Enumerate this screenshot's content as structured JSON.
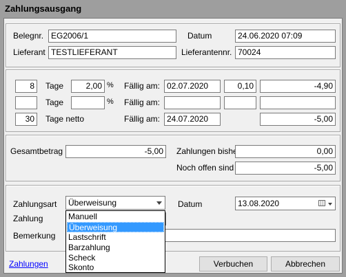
{
  "window": {
    "title": "Zahlungsausgang"
  },
  "header": {
    "belegnr_label": "Belegnr.",
    "belegnr_value": "EG2006/1",
    "datum_label": "Datum",
    "datum_value": "24.06.2020 07:09",
    "lieferant_label": "Lieferant",
    "lieferant_value": "TESTLIEFERANT",
    "lieferantennr_label": "Lieferantennr.",
    "lieferantennr_value": "70024"
  },
  "terms": {
    "rows": [
      {
        "days": "8",
        "tage_label": "Tage",
        "percent": "2,00",
        "pct_sign": "%",
        "faellig_label": "Fällig am:",
        "date": "02.07.2020",
        "amount_a": "0,10",
        "amount_b": "-4,90"
      },
      {
        "days": "",
        "tage_label": "Tage",
        "percent": "",
        "pct_sign": "%",
        "faellig_label": "Fällig am:",
        "date": "",
        "amount_a": "",
        "amount_b": ""
      },
      {
        "days": "30",
        "tage_label": "Tage netto",
        "faellig_label": "Fällig am:",
        "date": "24.07.2020",
        "amount_b": "-5,00"
      }
    ]
  },
  "totals": {
    "gesamtbetrag_label": "Gesamtbetrag",
    "gesamtbetrag_value": "-5,00",
    "zahlungen_bisher_label": "Zahlungen bisher",
    "zahlungen_bisher_value": "0,00",
    "noch_offen_label": "Noch offen sind",
    "noch_offen_value": "-5,00"
  },
  "payment": {
    "zahlungsart_label": "Zahlungsart",
    "zahlungsart_selected": "Überweisung",
    "datum_label": "Datum",
    "datum_value": "13.08.2020",
    "zahlung_label": "Zahlung",
    "bemerkung_label": "Bemerkung",
    "options": [
      "Manuell",
      "Überweisung",
      "Lastschrift",
      "Barzahlung",
      "Scheck",
      "Skonto"
    ],
    "highlighted_option": "Überweisung"
  },
  "footer": {
    "zahlungen_link": "Zahlungen",
    "verbuchen_button": "Verbuchen",
    "abbrechen_button": "Abbrechen"
  },
  "colors": {
    "highlight": "#3399ff",
    "link": "#0000ff",
    "frame": "#9e9e9e"
  }
}
